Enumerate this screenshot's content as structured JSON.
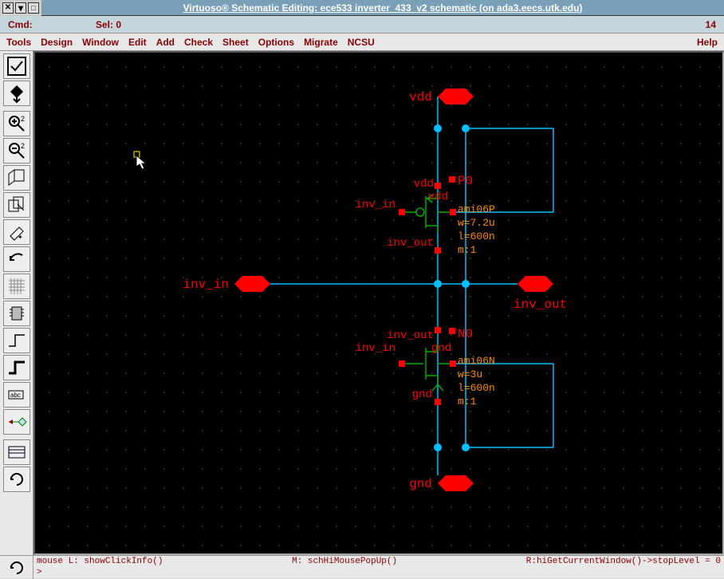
{
  "title": "Virtuoso® Schematic Editing: ece533 inverter_433_v2 schematic  (on ada3.eecs.utk.edu)",
  "status": {
    "cmd_label": "Cmd:",
    "sel_label": "Sel: 0",
    "count": "14"
  },
  "menu": {
    "tools": "Tools",
    "design": "Design",
    "window": "Window",
    "edit": "Edit",
    "add": "Add",
    "check": "Check",
    "sheet": "Sheet",
    "options": "Options",
    "migrate": "Migrate",
    "ncsu": "NCSU",
    "help": "Help"
  },
  "schematic": {
    "pins": {
      "vdd": "vdd",
      "gnd": "gnd",
      "inv_in": "inv_in",
      "inv_out": "inv_out"
    },
    "pmos": {
      "inst": "P0",
      "model": "ami06P",
      "w": "w=7.2u",
      "l": "l=600n",
      "m": "m:1",
      "d_net": "vdd",
      "g_net": "inv_in",
      "s_net": "inv_out",
      "b_net": "vdd"
    },
    "nmos": {
      "inst": "N0",
      "model": "ami06N",
      "w": "w=3u",
      "l": "l=600n",
      "m": "m:1",
      "d_net": "inv_out",
      "g_net": "inv_in",
      "s_net": "gnd",
      "b_net": "gnd"
    }
  },
  "info": {
    "mouse_l": "mouse L: showClickInfo()",
    "mouse_m": "M: schHiMousePopUp()",
    "mouse_r": "R:hiGetCurrentWindow()->stopLevel = 0",
    "prompt": ">"
  }
}
